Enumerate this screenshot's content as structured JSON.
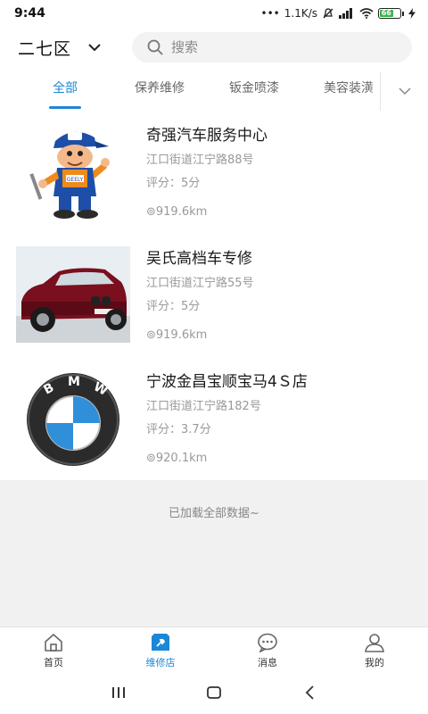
{
  "status_bar": {
    "time": "9:44",
    "net_speed": "1.1K/s",
    "battery_level": "66"
  },
  "header": {
    "district": "二七区",
    "search_placeholder": "搜索"
  },
  "tabs": [
    {
      "label": "全部",
      "active": true
    },
    {
      "label": "保养维修",
      "active": false
    },
    {
      "label": "钣金喷漆",
      "active": false
    },
    {
      "label": "美容装潢",
      "active": false
    }
  ],
  "shops": [
    {
      "name": "奇强汽车服务中心",
      "address": "江口街道江宁路88号",
      "score_label": "评分：",
      "score": "5分",
      "distance": "⊚919.6km",
      "thumb": "mechanic-mascot"
    },
    {
      "name": "吴氏高档车专修",
      "address": "江口街道江宁路55号",
      "score_label": "评分：",
      "score": "5分",
      "distance": "⊚919.6km",
      "thumb": "red-suv"
    },
    {
      "name": "宁波金昌宝顺宝马4Ｓ店",
      "address": "江口街道江宁路182号",
      "score_label": "评分：",
      "score": "3.7分",
      "distance": "⊚920.1km",
      "thumb": "bmw-logo"
    }
  ],
  "load_status": "已加载全部数据~",
  "bottom_nav": [
    {
      "label": "首页",
      "icon": "home-icon",
      "active": false
    },
    {
      "label": "维修店",
      "icon": "repair-shop-icon",
      "active": true
    },
    {
      "label": "消息",
      "icon": "message-icon",
      "active": false
    },
    {
      "label": "我的",
      "icon": "profile-icon",
      "active": false
    }
  ],
  "colors": {
    "accent": "#1c87d6",
    "text_primary": "#1a1a1a",
    "text_secondary": "#999999",
    "footer_bg": "#f1f1f1"
  }
}
